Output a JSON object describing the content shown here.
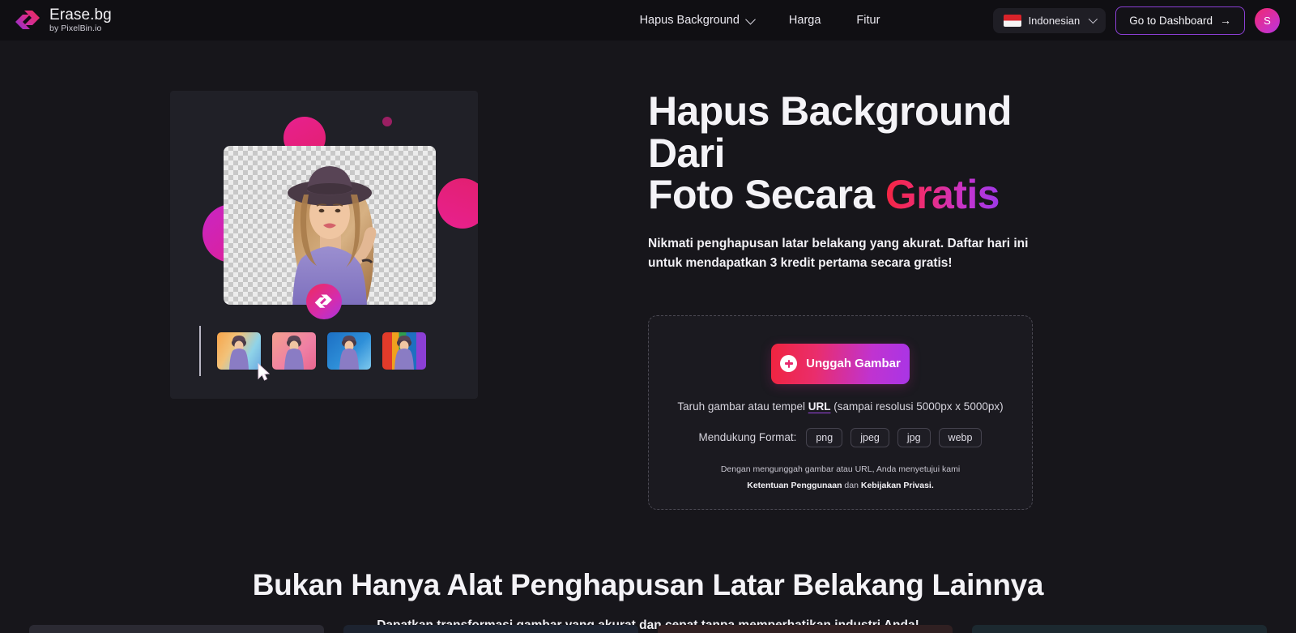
{
  "brand": {
    "title": "Erase.bg",
    "subtitle": "by PixelBin.io",
    "logo_icon": "erasebg-diamond-logo-icon"
  },
  "nav": {
    "links": [
      {
        "label": "Hapus Background",
        "has_dropdown": true,
        "icon": "chevron-down-icon"
      },
      {
        "label": "Harga",
        "has_dropdown": false
      },
      {
        "label": "Fitur",
        "has_dropdown": false
      }
    ],
    "language": {
      "label": "Indonesian",
      "flag_icon": "indonesia-flag-icon",
      "chevron_icon": "chevron-down-icon"
    },
    "dashboard_button": {
      "label": "Go to Dashboard",
      "arrow_icon": "arrow-right-icon"
    },
    "avatar": {
      "initial": "S"
    }
  },
  "hero": {
    "heading_line1": "Hapus Background Dari",
    "heading_line2_plain": "Foto Secara ",
    "heading_line2_accent": "Gratis",
    "subheading": "Nikmati penghapusan latar belakang yang akurat. Daftar hari ini untuk mendapatkan 3 kredit pertama secara gratis!",
    "artwork": {
      "name": "background-removal-preview-illustration",
      "badge_icon": "erasebg-logo-badge-icon",
      "cursor_icon": "mouse-cursor-icon",
      "thumbnails": [
        "thumbnail-gradient-sunset",
        "thumbnail-pink-solid",
        "thumbnail-blue-studio",
        "thumbnail-rainbow-stripes"
      ]
    }
  },
  "upload": {
    "button_label": "Unggah Gambar",
    "button_icon": "plus-circle-icon",
    "drop_text_before": "Taruh gambar atau tempel ",
    "drop_url_label": "URL",
    "drop_text_after": " (sampai resolusi 5000px x 5000px)",
    "formats_label": "Mendukung Format:",
    "formats": [
      "png",
      "jpeg",
      "jpg",
      "webp"
    ],
    "terms_before": "Dengan mengunggah gambar atau URL, Anda menyetujui kami ",
    "terms_link1": "Ketentuan Penggunaan",
    "terms_middle": " dan ",
    "terms_link2": "Kebijakan Privasi."
  },
  "section2": {
    "heading": "Bukan Hanya Alat Penghapusan Latar Belakang Lainnya",
    "subheading": "Dapatkan transformasi gambar yang akurat dan cepat tanpa memperhatikan industri Anda!"
  },
  "colors": {
    "page_background": "#17161b",
    "navbar_background": "#100f13",
    "accent_pink": "#ea2d6b",
    "accent_purple": "#a935e6",
    "accent_red": "#f0243f",
    "text_primary": "#f4f3f7",
    "text_muted": "#d6d4dd",
    "dashboard_border": "#8b3fd4"
  }
}
